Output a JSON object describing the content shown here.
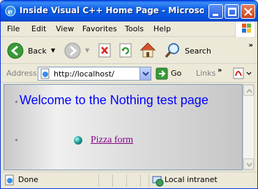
{
  "window": {
    "title": "Inside Visual C++ Home Page - Microsoft"
  },
  "menu": {
    "file": "File",
    "edit": "Edit",
    "view": "View",
    "favorites": "Favorites",
    "tools": "Tools",
    "help": "Help"
  },
  "toolbar": {
    "back_label": "Back",
    "search_label": "Search"
  },
  "address": {
    "label": "Address",
    "url": "http://localhost/",
    "go_label": "Go",
    "links_label": "Links"
  },
  "page": {
    "heading": "Welcome to the Nothing test page",
    "link_text": "Pizza form"
  },
  "status": {
    "left": "Done",
    "zone": "Local intranet"
  },
  "colors": {
    "titlebar": "#0553de",
    "heading": "#0000ff",
    "visited_link": "#800080"
  }
}
